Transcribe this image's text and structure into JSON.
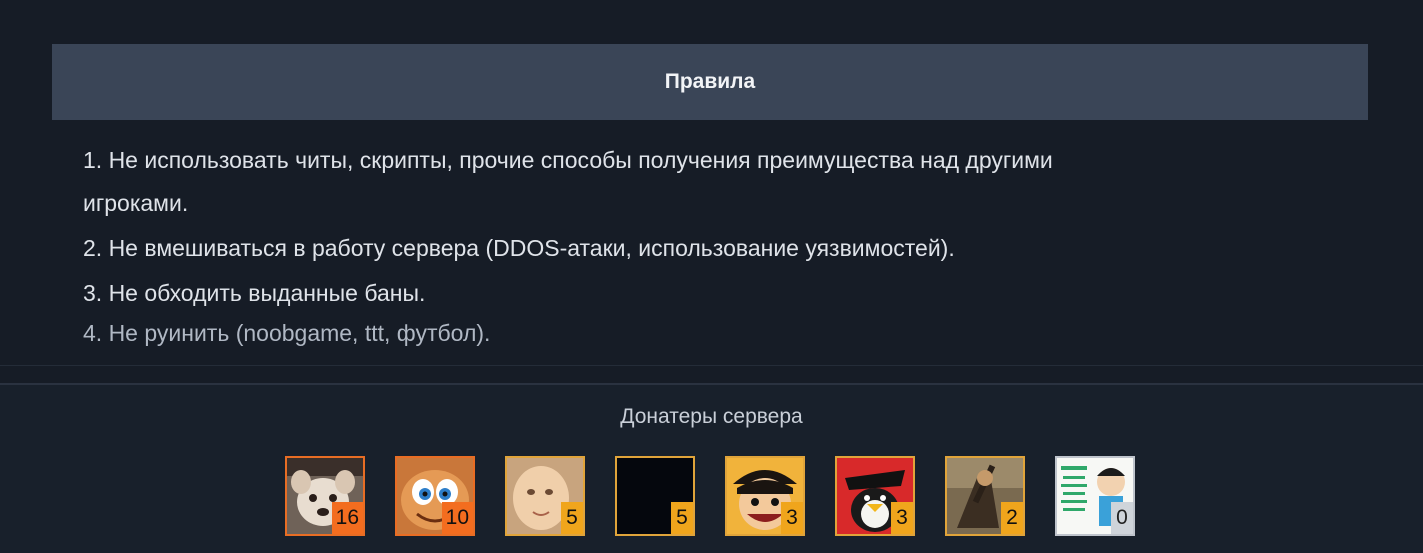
{
  "rules": {
    "title": "Правила",
    "items": [
      "1. Не использовать читы, скрипты, прочие способы получения преимущества над другими",
      "игроками.",
      "2. Не вмешиваться в работу сервера (DDOS-атаки, использование уязвимостей).",
      "3. Не обходить выданные баны.",
      "4. Не руинить (noobgame, ttt, футбол)."
    ]
  },
  "donors": {
    "title": "Донатеры сервера",
    "list": [
      {
        "count": "16",
        "icon": "dog-avatar-icon"
      },
      {
        "count": "10",
        "icon": "cartoon-face-avatar-icon"
      },
      {
        "count": "5",
        "icon": "baby-face-avatar-icon"
      },
      {
        "count": "5",
        "icon": "black-avatar-icon"
      },
      {
        "count": "3",
        "icon": "anime-pirate-avatar-icon"
      },
      {
        "count": "3",
        "icon": "penguin-avatar-icon"
      },
      {
        "count": "2",
        "icon": "soldier-avatar-icon"
      },
      {
        "count": "0",
        "icon": "meme-avatar-icon"
      }
    ]
  },
  "colors": {
    "background": "#161c26",
    "header_bar": "#3a4557",
    "badge_gold": "#f0a51c",
    "badge_orange": "#f36d1f",
    "badge_silver": "#cfd4da"
  }
}
